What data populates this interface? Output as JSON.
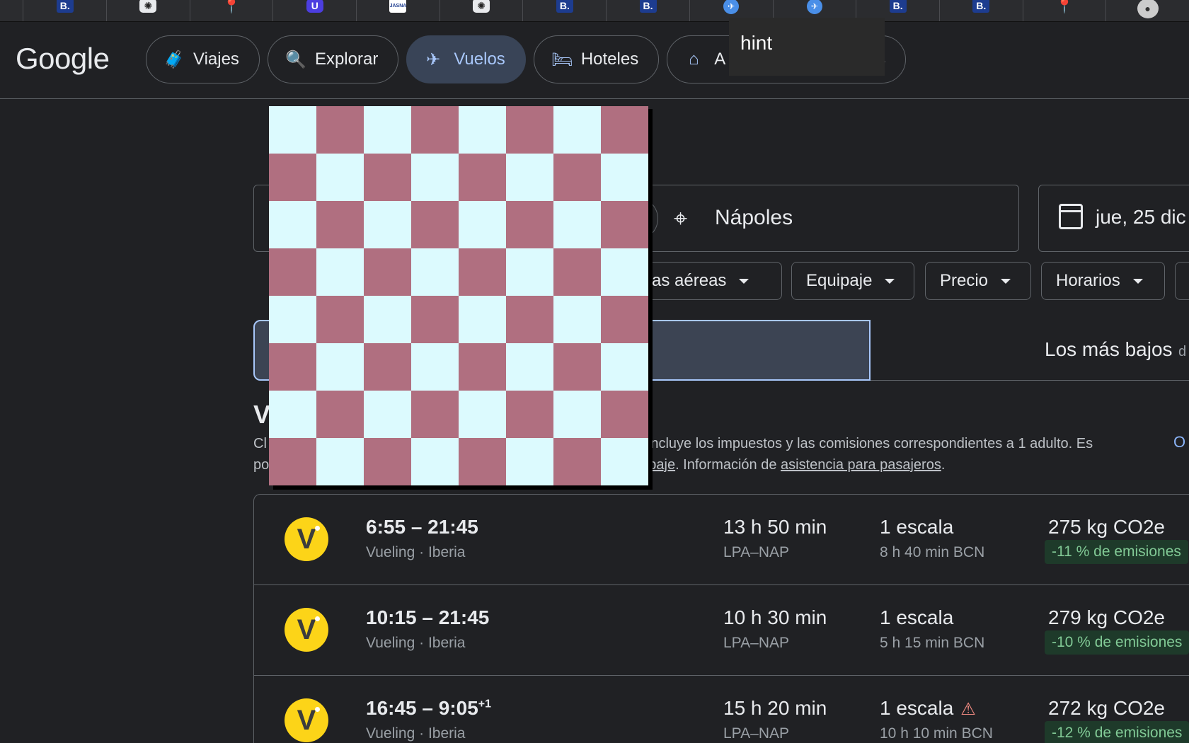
{
  "browser": {
    "tabs": [
      {
        "icon": "booking-icon",
        "glyph": "B."
      },
      {
        "icon": "openai-icon",
        "glyph": "✺"
      },
      {
        "icon": "maps-pin-icon",
        "glyph": "📍"
      },
      {
        "icon": "ux-icon",
        "glyph": "U"
      },
      {
        "icon": "jasna-icon",
        "glyph": "JASNA"
      },
      {
        "icon": "openai-icon",
        "glyph": "✺"
      },
      {
        "icon": "booking-icon",
        "glyph": "B."
      },
      {
        "icon": "booking-icon",
        "glyph": "B."
      },
      {
        "icon": "plane-icon",
        "glyph": "✈"
      },
      {
        "icon": "plane-icon",
        "glyph": "✈"
      },
      {
        "icon": "booking-icon",
        "glyph": "B."
      },
      {
        "icon": "booking-icon",
        "glyph": "B."
      },
      {
        "icon": "maps-pin-icon",
        "glyph": "📍"
      },
      {
        "icon": "github-icon",
        "glyph": "●"
      }
    ],
    "tooltip": "hint"
  },
  "header": {
    "logo": "Google",
    "nav": [
      {
        "label": "Viajes",
        "icon": "luggage-icon",
        "glyph": "🧳",
        "active": false
      },
      {
        "label": "Explorar",
        "icon": "explore-icon",
        "glyph": "🔍",
        "active": false
      },
      {
        "label": "Vuelos",
        "icon": "flight-icon",
        "glyph": "✈",
        "active": true
      },
      {
        "label": "Hoteles",
        "icon": "hotel-icon",
        "glyph": "🛏",
        "active": false
      },
      {
        "label": "A",
        "icon": "home-icon",
        "glyph": "⌂",
        "active": false,
        "suffix": "es"
      }
    ]
  },
  "search": {
    "destination": "Nápoles",
    "date": "jue, 25 dic"
  },
  "filters": {
    "airlines": "ñías aéreas",
    "baggage": "Equipaje",
    "price": "Precio",
    "times": "Horarios"
  },
  "sort": {
    "lowest": "Los más bajos",
    "lowest_sub": "d"
  },
  "results_header": {
    "title": "V",
    "notice_line1_prefix": "Cl",
    "notice_line1": "incluye los impuestos y las comisiones correspondientes a 1 adulto. Es",
    "notice_line2_prefix": "po",
    "notice_link1": "paje",
    "notice_mid": ". Información de ",
    "notice_link2": "asistencia para pasajeros",
    "notice_end": ".",
    "other_link": "O"
  },
  "flights": [
    {
      "airline_glyph": "V",
      "times": "6:55 – 21:45",
      "day_offset": "",
      "carriers": "Vueling · Iberia",
      "duration": "13 h 50 min",
      "route": "LPA–NAP",
      "stops": "1 escala",
      "warning": false,
      "stop_detail": "8 h 40 min BCN",
      "emissions": "275 kg CO2e",
      "emissions_delta": "-11 % de emisiones"
    },
    {
      "airline_glyph": "V",
      "times": "10:15 – 21:45",
      "day_offset": "",
      "carriers": "Vueling · Iberia",
      "duration": "10 h 30 min",
      "route": "LPA–NAP",
      "stops": "1 escala",
      "warning": false,
      "stop_detail": "5 h 15 min BCN",
      "emissions": "279 kg CO2e",
      "emissions_delta": "-10 % de emisiones"
    },
    {
      "airline_glyph": "V",
      "times": "16:45 – 9:05",
      "day_offset": "+1",
      "carriers": "Vueling · Iberia",
      "duration": "15 h 20 min",
      "route": "LPA–NAP",
      "stops": "1 escala",
      "warning": true,
      "stop_detail": "10 h 10 min BCN",
      "emissions": "272 kg CO2e",
      "emissions_delta": "-12 % de emisiones"
    }
  ],
  "overlay": {
    "checker_colors": {
      "light": "#dcfafe",
      "dark": "#b06f80"
    },
    "grid_size": 8
  }
}
